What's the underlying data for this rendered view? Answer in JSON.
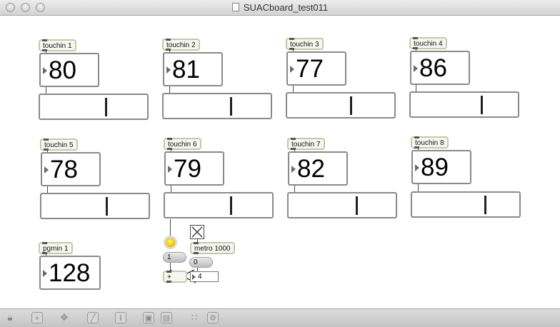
{
  "window": {
    "title": "SUACboard_test011"
  },
  "touchins": [
    {
      "label": "touchin 1",
      "value": "80",
      "level": 0.62
    },
    {
      "label": "touchin 2",
      "value": "81",
      "level": 0.63
    },
    {
      "label": "touchin 3",
      "value": "77",
      "level": 0.6
    },
    {
      "label": "touchin 4",
      "value": "86",
      "level": 0.67
    },
    {
      "label": "touchin 5",
      "value": "78",
      "level": 0.61
    },
    {
      "label": "touchin 6",
      "value": "79",
      "level": 0.62
    },
    {
      "label": "touchin 7",
      "value": "82",
      "level": 0.64
    },
    {
      "label": "touchin 8",
      "value": "89",
      "level": 0.69
    }
  ],
  "pgmin": {
    "label": "pgmin 1",
    "value": "128"
  },
  "counter": {
    "metro_label": "metro 1000",
    "left_message": "1",
    "right_message": "0",
    "plus_label": "+",
    "number_value": "4"
  },
  "toolbar": {
    "icons": [
      "lock-icon",
      "add-icon",
      "move-icon",
      "chart-icon",
      "info-icon",
      "window-icon",
      "window-stack-icon",
      "grid-icon",
      "gear-grid-icon"
    ]
  },
  "colors": {
    "object_border": "#c3c9a8",
    "led": "#f0c800"
  }
}
